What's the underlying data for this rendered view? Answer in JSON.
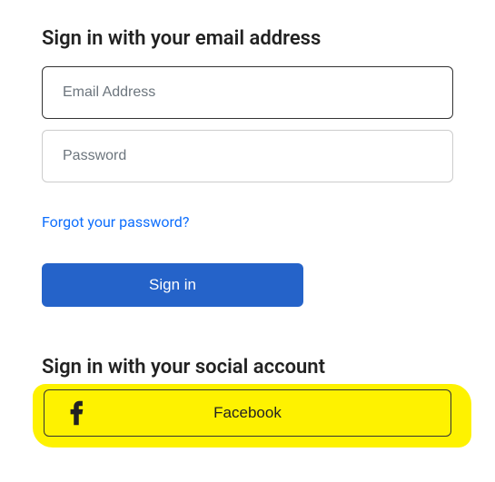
{
  "email_section": {
    "heading": "Sign in with your email address",
    "email_placeholder": "Email Address",
    "password_placeholder": "Password",
    "forgot_link": "Forgot your password?",
    "signin_label": "Sign in"
  },
  "social_section": {
    "heading": "Sign in with your social account",
    "facebook_label": "Facebook"
  }
}
